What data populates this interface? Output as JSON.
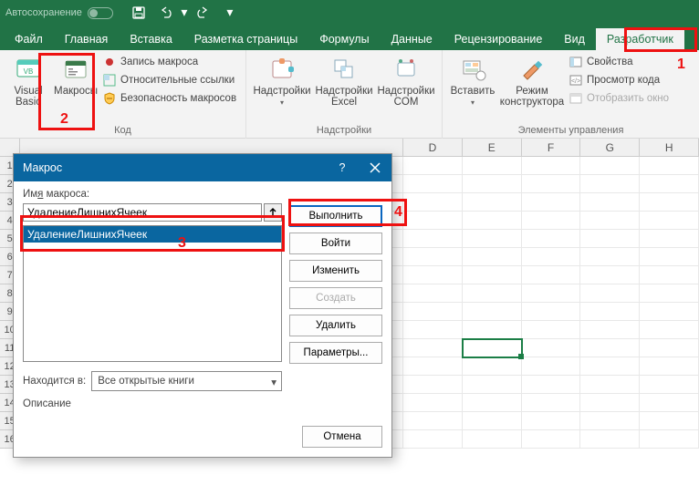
{
  "titlebar": {
    "autosave": "Автосохранение"
  },
  "tabs": {
    "file": "Файл",
    "home": "Главная",
    "insert": "Вставка",
    "pagelayout": "Разметка страницы",
    "formulas": "Формулы",
    "data": "Данные",
    "review": "Рецензирование",
    "view": "Вид",
    "developer": "Разработчик"
  },
  "ribbon": {
    "code": {
      "vb": "Visual\nBasic",
      "macros": "Макросы",
      "record": "Запись макроса",
      "relref": "Относительные ссылки",
      "security": "Безопасность макросов",
      "group": "Код"
    },
    "addins": {
      "addins": "Надстройки",
      "excel": "Надстройки\nExcel",
      "com": "Надстройки\nCOM",
      "group": "Надстройки"
    },
    "controls": {
      "insert": "Вставить",
      "design": "Режим\nконструктора",
      "props": "Свойства",
      "viewcode": "Просмотр кода",
      "rundlg": "Отобразить окно",
      "group": "Элементы управления"
    }
  },
  "columns": [
    "D",
    "E",
    "F",
    "G",
    "H"
  ],
  "rows": [
    "1",
    "2",
    "3",
    "4",
    "5",
    "6",
    "7",
    "8",
    "9",
    "10",
    "11",
    "12",
    "13",
    "14",
    "15",
    "16"
  ],
  "dialog": {
    "title": "Макрос",
    "name_label_pre": "Им",
    "name_label_ul": "я",
    "name_label_post": " макроса:",
    "name_value": "УдалениеЛишнихЯчеек",
    "list": [
      "УдалениеЛишнихЯчеек"
    ],
    "location_label_pre": "На",
    "location_label_ul": "х",
    "location_label_post": "одится в:",
    "location_value": "Все открытые книги",
    "desc_label": "Описание",
    "buttons": {
      "run": "Выполнить",
      "stepinto": "Войти",
      "edit": "Изменить",
      "create": "Создать",
      "delete": "Удалить",
      "options": "Параметры...",
      "cancel": "Отмена"
    }
  },
  "annot": {
    "n1": "1",
    "n2": "2",
    "n3": "3",
    "n4": "4"
  }
}
